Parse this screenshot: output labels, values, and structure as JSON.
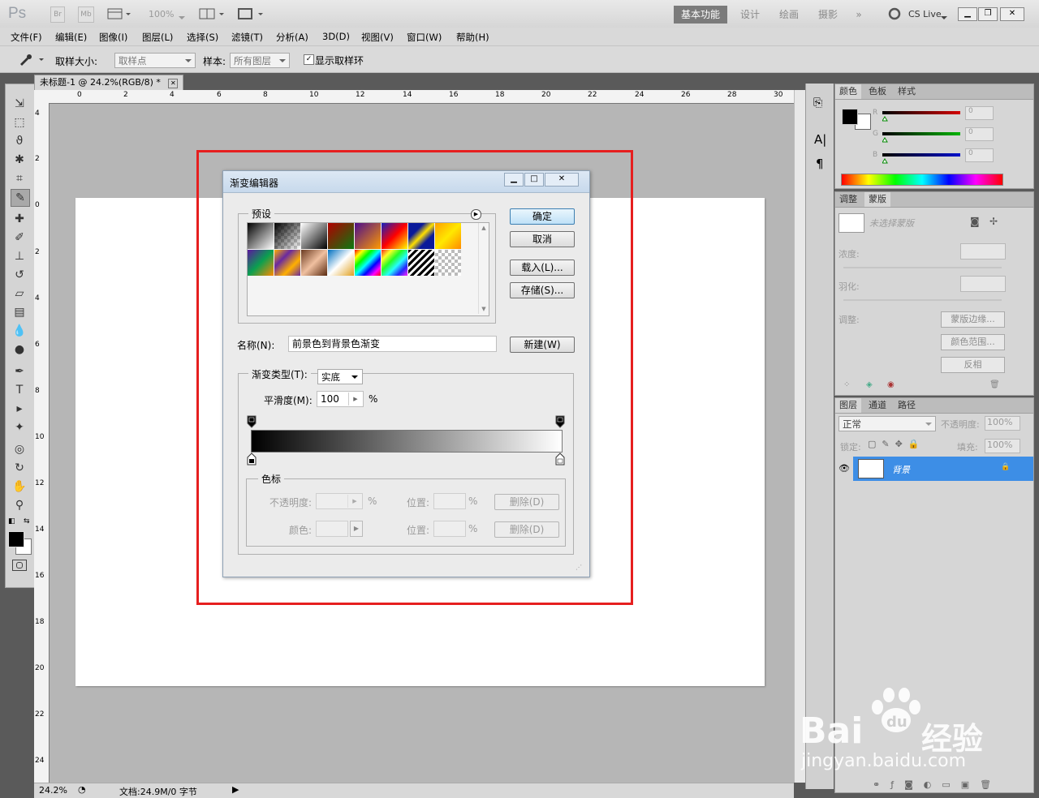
{
  "app": {
    "logo": "Ps",
    "bridge": "Br",
    "minibridge": "Mb",
    "zoom": "100%",
    "workspaces": [
      "基本功能",
      "设计",
      "绘画",
      "摄影",
      "»"
    ],
    "cslive": "CS Live"
  },
  "menu": [
    "文件(F)",
    "编辑(E)",
    "图像(I)",
    "图层(L)",
    "选择(S)",
    "滤镜(T)",
    "分析(A)",
    "3D(D)",
    "视图(V)",
    "窗口(W)",
    "帮助(H)"
  ],
  "options": {
    "sample_size_label": "取样大小:",
    "sample_size_value": "取样点",
    "sample_label": "样本:",
    "sample_value": "所有图层",
    "show_ring_label": "显示取样环"
  },
  "document": {
    "tab_title": "未标题-1 @ 24.2%(RGB/8) *",
    "ruler_h": [
      "0",
      "2",
      "4",
      "6",
      "8",
      "10",
      "12",
      "14",
      "16",
      "18",
      "20",
      "22",
      "24",
      "26",
      "28",
      "30"
    ],
    "ruler_v": [
      "4",
      "2",
      "0",
      "2",
      "4",
      "6",
      "8",
      "10",
      "12",
      "14",
      "16",
      "18",
      "20",
      "22",
      "24"
    ],
    "zoom": "24.2%",
    "doc_info": "文档:24.9M/0 字节"
  },
  "color_panel": {
    "tabs": [
      "颜色",
      "色板",
      "样式"
    ],
    "channels": [
      {
        "name": "R",
        "value": "0",
        "color": "#d40000"
      },
      {
        "name": "G",
        "value": "0",
        "color": "#00b400"
      },
      {
        "name": "B",
        "value": "0",
        "color": "#0010cc"
      }
    ]
  },
  "mask_panel": {
    "tabs": [
      "调整",
      "蒙版"
    ],
    "no_mask": "未选择蒙版",
    "density": "浓度:",
    "feather": "羽化:",
    "adjust": "调整:",
    "btn_edge": "蒙版边缘...",
    "btn_range": "颜色范围...",
    "btn_invert": "反相"
  },
  "layers_panel": {
    "tabs": [
      "图层",
      "通道",
      "路径"
    ],
    "blend": "正常",
    "opacity_label": "不透明度:",
    "opacity": "100%",
    "lock_label": "锁定:",
    "fill_label": "填充:",
    "fill": "100%",
    "layer_name": "背景"
  },
  "dialog": {
    "title": "渐变编辑器",
    "presets_label": "预设",
    "ok": "确定",
    "cancel": "取消",
    "load": "载入(L)...",
    "save": "存储(S)...",
    "name_label": "名称(N):",
    "name_value": "前景色到背景色渐变",
    "new": "新建(W)",
    "type_label": "渐变类型(T):",
    "type_value": "实底",
    "smooth_label": "平滑度(M):",
    "smooth_value": "100",
    "percent": "%",
    "stops_label": "色标",
    "opacity_label": "不透明度:",
    "location_label": "位置:",
    "color_label": "颜色:",
    "delete": "删除(D)"
  },
  "watermark": {
    "brand": "Bai",
    "brand2": "du",
    "cn": "经验",
    "url": "jingyan.baidu.com"
  }
}
